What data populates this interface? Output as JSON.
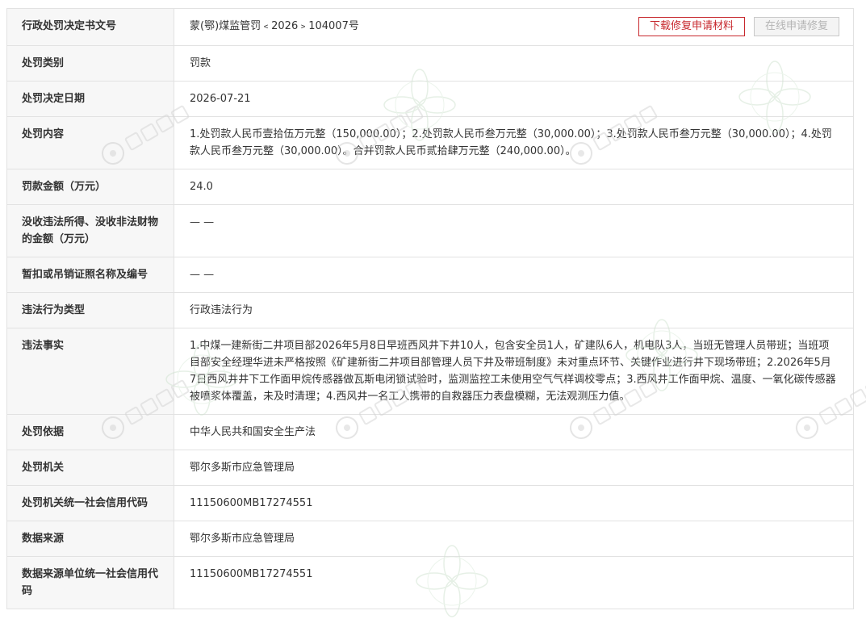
{
  "actions": {
    "download_label": "下载修复申请材料",
    "online_label": "在线申请修复"
  },
  "rows": [
    {
      "label": "行政处罚决定书文号",
      "value": "蒙(鄂)煤监管罚﹤2026﹥104007号"
    },
    {
      "label": "处罚类别",
      "value": "罚款"
    },
    {
      "label": "处罚决定日期",
      "value": "2026-07-21"
    },
    {
      "label": "处罚内容",
      "value": "1.处罚款人民币壹拾伍万元整（150,000.00）；2.处罚款人民币叁万元整（30,000.00）；3.处罚款人民币叁万元整（30,000.00）；4.处罚款人民币叁万元整（30,000.00）。合并罚款人民币贰拾肆万元整（240,000.00）。"
    },
    {
      "label": "罚款金额（万元）",
      "value": "24.0"
    },
    {
      "label": "没收违法所得、没收非法财物的金额（万元）",
      "value": "— —"
    },
    {
      "label": "暂扣或吊销证照名称及编号",
      "value": "— —"
    },
    {
      "label": "违法行为类型",
      "value": "行政违法行为"
    },
    {
      "label": "违法事实",
      "value": "1.中煤一建新街二井项目部2026年5月8日早班西风井下井10人，包含安全员1人，矿建队6人，机电队3人，当班无管理人员带班；当班项目部安全经理华进未严格按照《矿建新街二井项目部管理人员下井及带班制度》未对重点环节、关键作业进行井下现场带班；2.2026年5月7日西风井井下工作面甲烷传感器做瓦斯电闭锁试验时，监测监控工未使用空气气样调校零点；3.西风井工作面甲烷、温度、一氧化碳传感器被喷浆体覆盖，未及时清理；4.西风井一名工人携带的自救器压力表盘模糊，无法观测压力值。"
    },
    {
      "label": "处罚依据",
      "value": "中华人民共和国安全生产法"
    },
    {
      "label": "处罚机关",
      "value": "鄂尔多斯市应急管理局"
    },
    {
      "label": "处罚机关统一社会信用代码",
      "value": "11150600MB17274551"
    },
    {
      "label": "数据来源",
      "value": "鄂尔多斯市应急管理局"
    },
    {
      "label": "数据来源单位统一社会信用代码",
      "value": "11150600MB17274551"
    }
  ]
}
